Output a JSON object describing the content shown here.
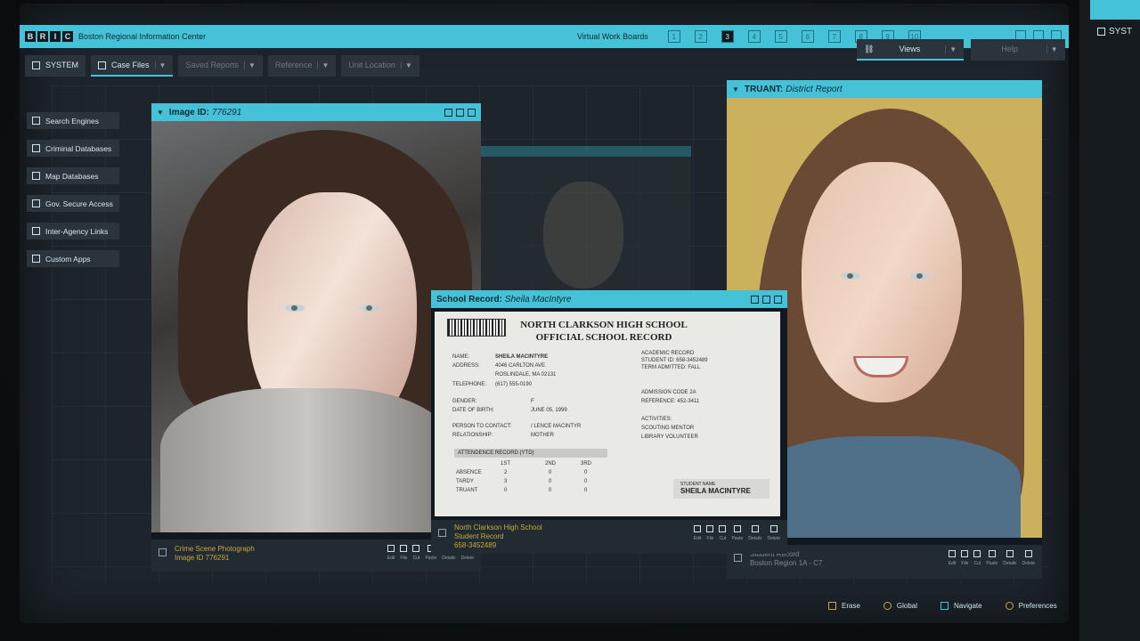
{
  "app": {
    "logo_letters": [
      "B",
      "R",
      "I",
      "C"
    ],
    "title": "Boston Regional Information Center"
  },
  "virtual_boards": {
    "label": "Virtual Work Boards",
    "boards": [
      "1",
      "2",
      "3",
      "4",
      "5",
      "6",
      "7",
      "8",
      "9",
      "10"
    ],
    "active_index": 2
  },
  "toolbar": {
    "system": "SYSTEM",
    "case_files": "Case Files",
    "saved_reports": "Saved Reports",
    "reference": "Reference",
    "unit_location": "Unit Location",
    "views": "Views",
    "help": "Help"
  },
  "sidebar": {
    "items": [
      {
        "label": "Search Engines",
        "icon": "search-engines-icon"
      },
      {
        "label": "Criminal Databases",
        "icon": "database-grid-icon"
      },
      {
        "label": "Map Databases",
        "icon": "map-icon"
      },
      {
        "label": "Gov. Secure Access",
        "icon": "lock-icon"
      },
      {
        "label": "Inter-Agency Links",
        "icon": "link-icon"
      },
      {
        "label": "Custom Apps",
        "icon": "app-square-icon"
      }
    ]
  },
  "image_window": {
    "title_bold": "Image ID:",
    "title_italic": "776291",
    "footer_line1": "Crime Scene Photograph",
    "footer_line2": "Image ID 776291",
    "tools": [
      "Edit",
      "File",
      "Cut",
      "Paste",
      "Details",
      "Delete"
    ]
  },
  "truant_window": {
    "title_bold": "TRUANT:",
    "title_italic": "District Report",
    "footer_line1": "Student Record",
    "footer_line2": "Boston Region 1A - C7",
    "tools": [
      "Edit",
      "File",
      "Cut",
      "Paste",
      "Details",
      "Delete"
    ]
  },
  "record_window": {
    "title_bold": "School Record:",
    "title_italic": "Sheila MacIntyre",
    "school_line1": "NORTH CLARKSON HIGH SCHOOL",
    "school_line2": "OFFICIAL SCHOOL RECORD",
    "name_label": "NAME:",
    "name": "SHEILA MACINTYRE",
    "address_label": "ADDRESS:",
    "address1": "4046 CARLTON AVE",
    "address2": "ROSLINDALE, MA 02131",
    "telephone_label": "TELEPHONE:",
    "telephone": "(617) 555-0190",
    "gender_label": "GENDER:",
    "gender": "F",
    "dob_label": "DATE OF BIRTH:",
    "dob": "JUNE 05, 1999",
    "contact_label": "PERSON TO CONTACT:",
    "contact": "/ LENCE MACINTYR",
    "relationship_label": "RELATIONSHIP:",
    "relationship": "MOTHER",
    "academic_label": "ACADEMIC RECORD",
    "student_id": "STUDENT ID: 658-3452489",
    "term": "TERM ADMITTED: FALL",
    "admission": "ADMISSION CODE 2A",
    "reference": "REFERENCE: 452-3411",
    "activities_label": "ACTIVITIES:",
    "activity1": "SCOUTING MENTOR",
    "activity2": "LIBRARY VOLUNTEER",
    "attendance_label": "ATTENDENCE RECORD (YTD)",
    "att_cols": [
      "1ST",
      "2ND",
      "3RD"
    ],
    "att_rows": [
      {
        "label": "ABSENCE",
        "values": [
          "2",
          "0",
          "0"
        ]
      },
      {
        "label": "TARDY",
        "values": [
          "3",
          "0",
          "0"
        ]
      },
      {
        "label": "TRUANT",
        "values": [
          "0",
          "0",
          "0"
        ]
      }
    ],
    "stamp_label": "STUDENT NAME",
    "stamp_name": "SHEILA MACINTYRE",
    "footer_line1": "North Clarkson High School",
    "footer_line2": "Student Record",
    "footer_line3": "658-3452489",
    "tools": [
      "Edit",
      "File",
      "Cut",
      "Paste",
      "Details",
      "Delete"
    ]
  },
  "bottombar": {
    "erase": "Erase",
    "global": "Global",
    "navigate": "Navigate",
    "preferences": "Preferences"
  },
  "side_monitor": {
    "system": "SYST"
  },
  "colors": {
    "accent": "#46c2d8",
    "footer_text": "#c7a83c",
    "panel": "#2b343c"
  }
}
